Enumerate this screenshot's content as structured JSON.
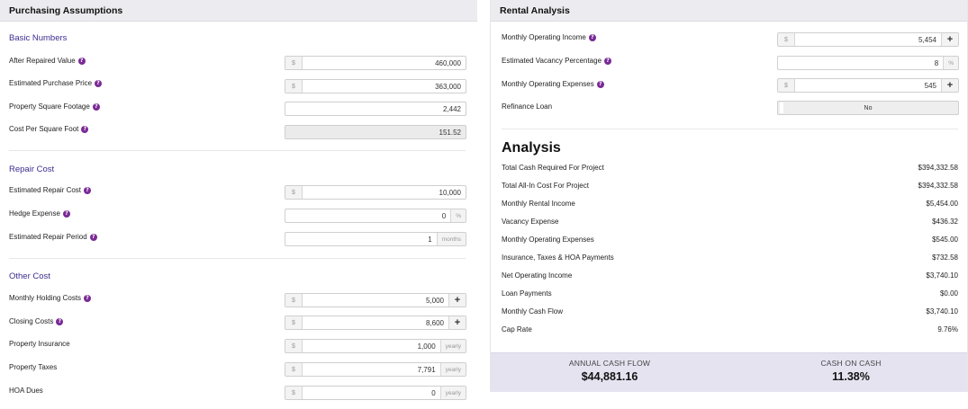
{
  "purchasing": {
    "header": "Purchasing Assumptions",
    "basic": {
      "title": "Basic Numbers",
      "arv_label": "After Repaired Value",
      "arv_prefix": "$",
      "arv_value": "460,000",
      "price_label": "Estimated Purchase Price",
      "price_prefix": "$",
      "price_value": "363,000",
      "sqft_label": "Property Square Footage",
      "sqft_value": "2,442",
      "cpsf_label": "Cost Per Square Foot",
      "cpsf_value": "151.52"
    },
    "repair": {
      "title": "Repair Cost",
      "cost_label": "Estimated Repair Cost",
      "cost_prefix": "$",
      "cost_value": "10,000",
      "hedge_label": "Hedge Expense",
      "hedge_value": "0",
      "hedge_suffix": "%",
      "period_label": "Estimated Repair Period",
      "period_value": "1",
      "period_suffix": "months"
    },
    "other": {
      "title": "Other Cost",
      "holding_label": "Monthly Holding Costs",
      "holding_prefix": "$",
      "holding_value": "5,000",
      "closing_label": "Closing Costs",
      "closing_prefix": "$",
      "closing_value": "8,600",
      "insurance_label": "Property Insurance",
      "insurance_prefix": "$",
      "insurance_value": "1,000",
      "insurance_suffix": "yearly",
      "taxes_label": "Property Taxes",
      "taxes_prefix": "$",
      "taxes_value": "7,791",
      "taxes_suffix": "yearly",
      "hoa_label": "HOA Dues",
      "hoa_prefix": "$",
      "hoa_value": "0",
      "hoa_suffix": "yearly"
    }
  },
  "rental": {
    "header": "Rental Analysis",
    "income_label": "Monthly Operating Income",
    "income_prefix": "$",
    "income_value": "5,454",
    "vacancy_label": "Estimated Vacancy Percentage",
    "vacancy_value": "8",
    "vacancy_suffix": "%",
    "expenses_label": "Monthly Operating Expenses",
    "expenses_prefix": "$",
    "expenses_value": "545",
    "refinance_label": "Refinance Loan",
    "refinance_value": "No"
  },
  "analysis": {
    "title": "Analysis",
    "rows": [
      {
        "label": "Total Cash Required For Project",
        "value": "$394,332.58"
      },
      {
        "label": "Total All-In Cost For Project",
        "value": "$394,332.58"
      },
      {
        "label": "Monthly Rental Income",
        "value": "$5,454.00"
      },
      {
        "label": "Vacancy Expense",
        "value": "$436.32"
      },
      {
        "label": "Monthly Operating Expenses",
        "value": "$545.00"
      },
      {
        "label": "Insurance, Taxes & HOA Payments",
        "value": "$732.58"
      },
      {
        "label": "Net Operating Income",
        "value": "$3,740.10"
      },
      {
        "label": "Loan Payments",
        "value": "$0.00"
      },
      {
        "label": "Monthly Cash Flow",
        "value": "$3,740.10"
      },
      {
        "label": "Cap Rate",
        "value": "9.76%"
      }
    ]
  },
  "summary": {
    "annual_label": "ANNUAL CASH FLOW",
    "annual_value": "$44,881.16",
    "coc_label": "CASH ON CASH",
    "coc_value": "11.38%"
  },
  "icons": {
    "help": "question-circle-icon",
    "add": "plus-icon"
  },
  "colors": {
    "accent": "#3b2d8f",
    "help_badge": "#7a2a95",
    "header_bg": "#ececf0",
    "summary_bg": "#e5e3f0"
  }
}
